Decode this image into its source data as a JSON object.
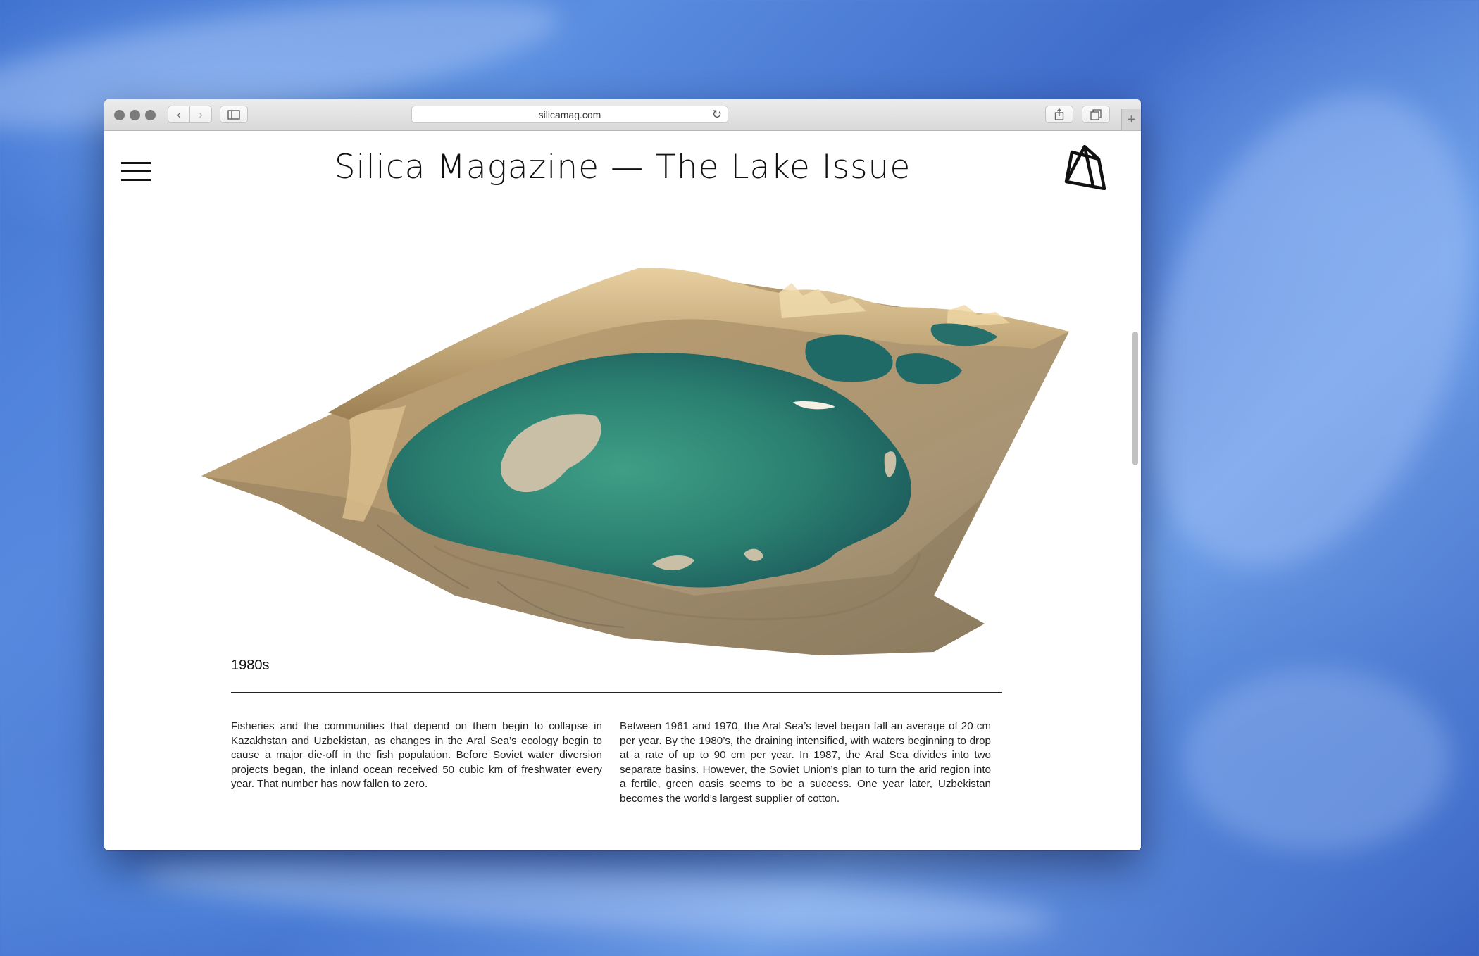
{
  "browser": {
    "url": "silicamag.com"
  },
  "site": {
    "title": "Silica Magazine — The Lake Issue"
  },
  "article": {
    "era_label": "1980s",
    "paragraph_left": "Fisheries and the communities that depend on them begin to collapse in Kazakhstan and Uzbekistan, as changes in the Aral Sea’s ecology begin to cause a major die-off in the fish population. Before Soviet water diversion projects began, the inland ocean received 50 cubic km of freshwater every year. That number has now fallen to zero.",
    "paragraph_right": "Between 1961 and 1970, the Aral Sea’s level began fall an average of 20 cm per year. By the 1980’s, the draining intensified, with waters beginning to drop at a rate of up to 90 cm per year. In 1987, the Aral Sea divides into two separate basins. However, the Soviet Union’s plan to turn the arid region into a fertile, green oasis seems to be a success. One year later, Uzbekistan becomes the world’s largest supplier of cotton."
  }
}
